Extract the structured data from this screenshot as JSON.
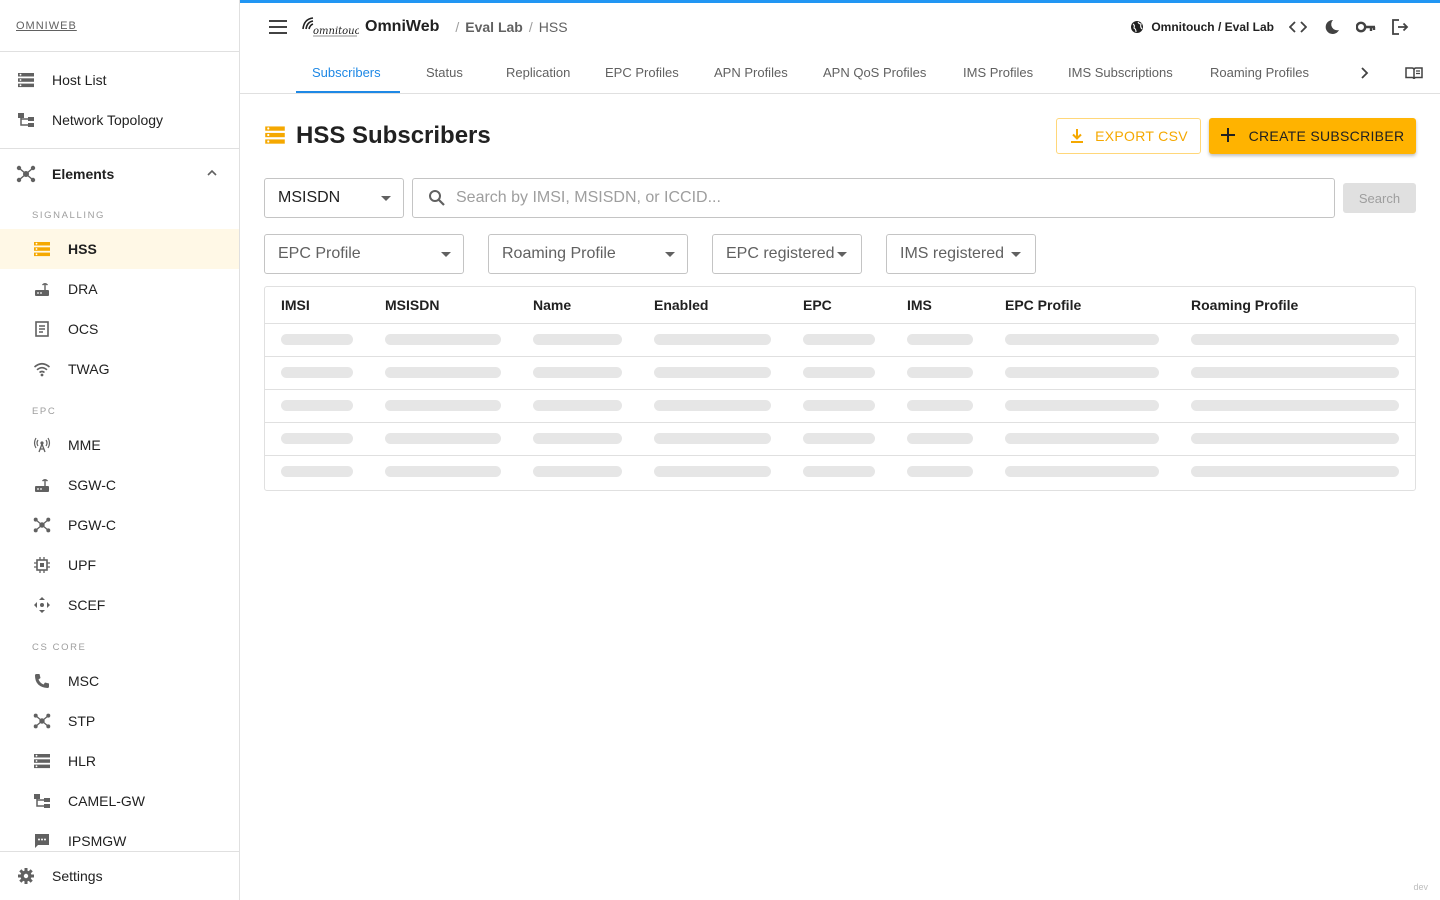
{
  "brand": "OMNIWEB",
  "sidebar": {
    "top_items": [
      {
        "label": "Host List",
        "icon": "server-list-icon"
      },
      {
        "label": "Network Topology",
        "icon": "topology-icon"
      }
    ],
    "elements_label": "Elements",
    "sections": [
      {
        "label": "SIGNALLING",
        "items": [
          {
            "label": "HSS",
            "icon": "database-icon",
            "active": true
          },
          {
            "label": "DRA",
            "icon": "router-icon"
          },
          {
            "label": "OCS",
            "icon": "receipt-icon"
          },
          {
            "label": "TWAG",
            "icon": "wifi-icon"
          }
        ]
      },
      {
        "label": "EPC",
        "items": [
          {
            "label": "MME",
            "icon": "antenna-icon"
          },
          {
            "label": "SGW-C",
            "icon": "router-icon"
          },
          {
            "label": "PGW-C",
            "icon": "hub-icon"
          },
          {
            "label": "UPF",
            "icon": "chip-icon"
          },
          {
            "label": "SCEF",
            "icon": "move-icon"
          }
        ]
      },
      {
        "label": "CS CORE",
        "items": [
          {
            "label": "MSC",
            "icon": "phone-icon"
          },
          {
            "label": "STP",
            "icon": "hub-icon"
          },
          {
            "label": "HLR",
            "icon": "database-icon"
          },
          {
            "label": "CAMEL-GW",
            "icon": "topology-icon"
          },
          {
            "label": "IPSMGW",
            "icon": "sms-icon"
          }
        ]
      }
    ],
    "settings_label": "Settings"
  },
  "topbar": {
    "app_name": "OmniWeb",
    "breadcrumb": [
      "Eval Lab",
      "HSS"
    ],
    "tenant": "Omnitouch / Eval Lab"
  },
  "tabs": [
    "Subscribers",
    "Status",
    "Replication",
    "EPC Profiles",
    "APN Profiles",
    "APN QoS Profiles",
    "IMS Profiles",
    "IMS Subscriptions",
    "Roaming Profiles"
  ],
  "page": {
    "title": "HSS Subscribers",
    "export_label": "EXPORT CSV",
    "create_label": "CREATE SUBSCRIBER",
    "search_field": "MSISDN",
    "search_placeholder": "Search by IMSI, MSISDN, or ICCID...",
    "search_button": "Search",
    "filters": [
      "EPC Profile",
      "Roaming Profile",
      "EPC registered",
      "IMS registered"
    ]
  },
  "table": {
    "columns": [
      "IMSI",
      "MSISDN",
      "Name",
      "Enabled",
      "EPC",
      "IMS",
      "EPC Profile",
      "Roaming Profile"
    ],
    "skeleton_rows": 5
  },
  "footer_tag": "dev",
  "colors": {
    "accent": "#ffb300",
    "tab_active": "#1e88e5",
    "topline": "#2196f3"
  }
}
